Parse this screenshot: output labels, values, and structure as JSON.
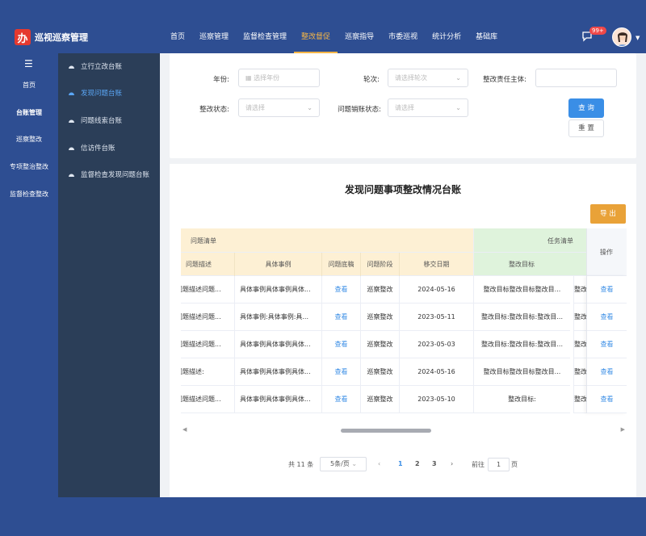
{
  "app": {
    "title": "巡视巡察管理",
    "logo_char": "办"
  },
  "topnav": [
    "首页",
    "巡察管理",
    "监督检查管理",
    "整改督促",
    "巡察指导",
    "市委巡视",
    "统计分析",
    "基础库"
  ],
  "notifications": {
    "count": "99+"
  },
  "sidebar": {
    "items": [
      "首页",
      "台账管理",
      "巡察整改",
      "专项整治整改",
      "监督检查整改"
    ],
    "active": "台账管理"
  },
  "subnav": {
    "items": [
      "立行立改台账",
      "发现问题台账",
      "问题线索台账",
      "信访件台账",
      "监督检查发现问题台账"
    ],
    "active": "发现问题台账"
  },
  "filters": {
    "year_label": "年份:",
    "year_placeholder": "选择年份",
    "round_label": "轮次:",
    "round_placeholder": "请选择轮次",
    "subject_label": "整改责任主体:",
    "status_label": "整改状态:",
    "status_placeholder": "请选择",
    "closure_label": "问题销账状态:",
    "closure_placeholder": "请选择",
    "query_button": "查 询",
    "reset_button": "重 置"
  },
  "table": {
    "title": "发现问题事项整改情况台账",
    "export_button": "导 出",
    "group1": "问题清单",
    "group2": "任务清单",
    "ops_header": "操作",
    "columns": [
      "问题描述",
      "具体事例",
      "问题底稿",
      "问题阶段",
      "移交日期",
      "整改目标"
    ],
    "rows": [
      [
        "问题描述问题...",
        "具体事例具体事例具体...",
        "查看",
        "巡察整改",
        "2024-05-16",
        "整改目标整改目标整改目...",
        "整改",
        "查看"
      ],
      [
        "问题描述问题...",
        "具体事例:具体事例:具...",
        "查看",
        "巡察整改",
        "2023-05-11",
        "整改目标:整改目标:整改目...",
        "整改",
        "查看"
      ],
      [
        "问题描述问题...",
        "具体事例具体事例具体...",
        "查看",
        "巡察整改",
        "2023-05-03",
        "整改目标:整改目标:整改目...",
        "整改",
        "查看"
      ],
      [
        "问题描述:",
        "具体事例具体事例具体...",
        "查看",
        "巡察整改",
        "2024-05-16",
        "整改目标整改目标整改目...",
        "整改",
        "查看"
      ],
      [
        "问题描述问题...",
        "具体事例具体事例具体...",
        "查看",
        "巡察整改",
        "2023-05-10",
        "整改目标:",
        "整改",
        "查看"
      ]
    ]
  },
  "pagination": {
    "total": "共 11 条",
    "page_size": "5条/页",
    "pages": [
      "1",
      "2",
      "3"
    ],
    "current": "1",
    "goto_label": "前往",
    "goto_value": "1",
    "page_suffix": "页"
  },
  "colors": {
    "header": "#2e4e92",
    "subnav": "#2b3e58",
    "accent": "#3a8ee6",
    "active_top": "#f5b546",
    "export": "#e9a238",
    "group1_bg": "#fdf0d4",
    "group2_bg": "#dff3dc"
  }
}
